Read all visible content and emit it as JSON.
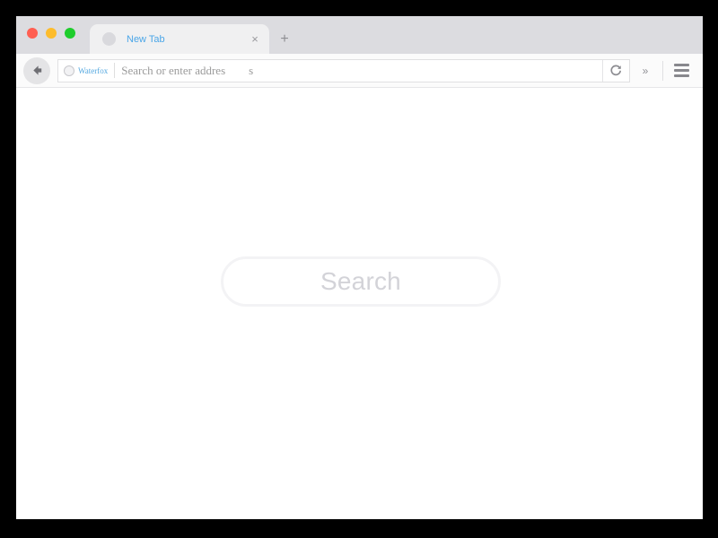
{
  "window": {
    "traffic_lights": [
      {
        "name": "close",
        "color": "#ff5f52"
      },
      {
        "name": "minimize",
        "color": "#fdbc2c"
      },
      {
        "name": "maximize",
        "color": "#1ecd2c"
      }
    ]
  },
  "tabstrip": {
    "tabs": [
      {
        "title": "New Tab",
        "favicon": "blank-favicon",
        "close_glyph": "×",
        "active": true
      }
    ],
    "new_tab_glyph": "+"
  },
  "toolbar": {
    "back_glyph": "←",
    "identity": {
      "label": "Waterfox",
      "icon": "globe-circle-icon"
    },
    "urlbar": {
      "placeholder_main": "Search or enter addres",
      "placeholder_overflow": "s",
      "value": ""
    },
    "reload_glyph": "↻",
    "overflow_glyph": "»",
    "menu_icon": "hamburger-icon"
  },
  "content": {
    "search": {
      "placeholder": "Search"
    }
  },
  "colors": {
    "tabstrip_bg": "#dcdce0",
    "active_tab_bg": "#f0f0f1",
    "tab_title": "#4ba6e8",
    "toolbar_bg": "#fbfbfb",
    "identity_label": "#54a8e0",
    "search_border": "#f3f3f5",
    "search_placeholder": "#d3d3d8"
  }
}
